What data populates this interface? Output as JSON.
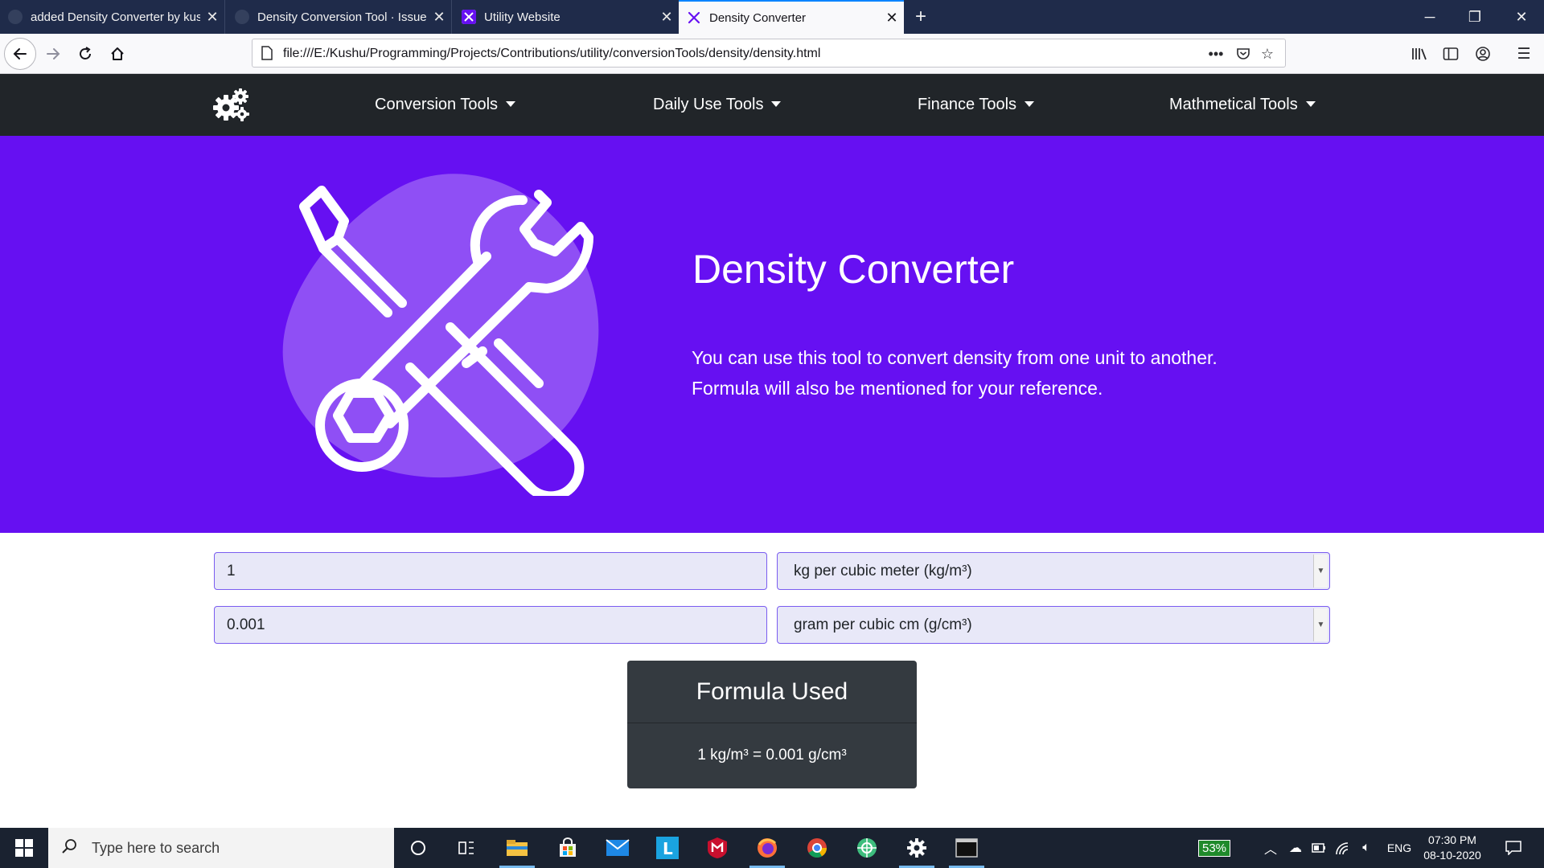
{
  "browser": {
    "tabs": [
      {
        "title": "added Density Converter by kushu",
        "active": false
      },
      {
        "title": "Density Conversion Tool · Issue",
        "active": false
      },
      {
        "title": "Utility Website",
        "active": false
      },
      {
        "title": "Density Converter",
        "active": true
      }
    ],
    "new_tab_label": "+",
    "url": "file:///E:/Kushu/Programming/Projects/Contributions/utility/conversionTools/density/density.html"
  },
  "site_nav": {
    "items": [
      {
        "label": "Conversion Tools"
      },
      {
        "label": "Daily Use Tools"
      },
      {
        "label": "Finance Tools"
      },
      {
        "label": "Mathmetical Tools"
      }
    ]
  },
  "hero": {
    "title": "Density Converter",
    "description_line1": "You can use this tool to convert density from one unit to another.",
    "description_line2": "Formula will also be mentioned for your reference."
  },
  "converter": {
    "from_value": "1",
    "from_unit": "kg per cubic meter (kg/m³)",
    "to_value": "0.001",
    "to_unit": "gram per cubic cm (g/cm³)"
  },
  "formula": {
    "heading": "Formula Used",
    "text": "1 kg/m³ = 0.001 g/cm³"
  },
  "taskbar": {
    "search_placeholder": "Type here to search",
    "battery_percent": "53%",
    "language": "ENG",
    "time": "07:30 PM",
    "date": "08-10-2020"
  },
  "colors": {
    "hero_background": "#6610f2",
    "navbar_background": "#212529",
    "formula_card": "#343a40",
    "tab_strip": "#1f2b4a"
  }
}
